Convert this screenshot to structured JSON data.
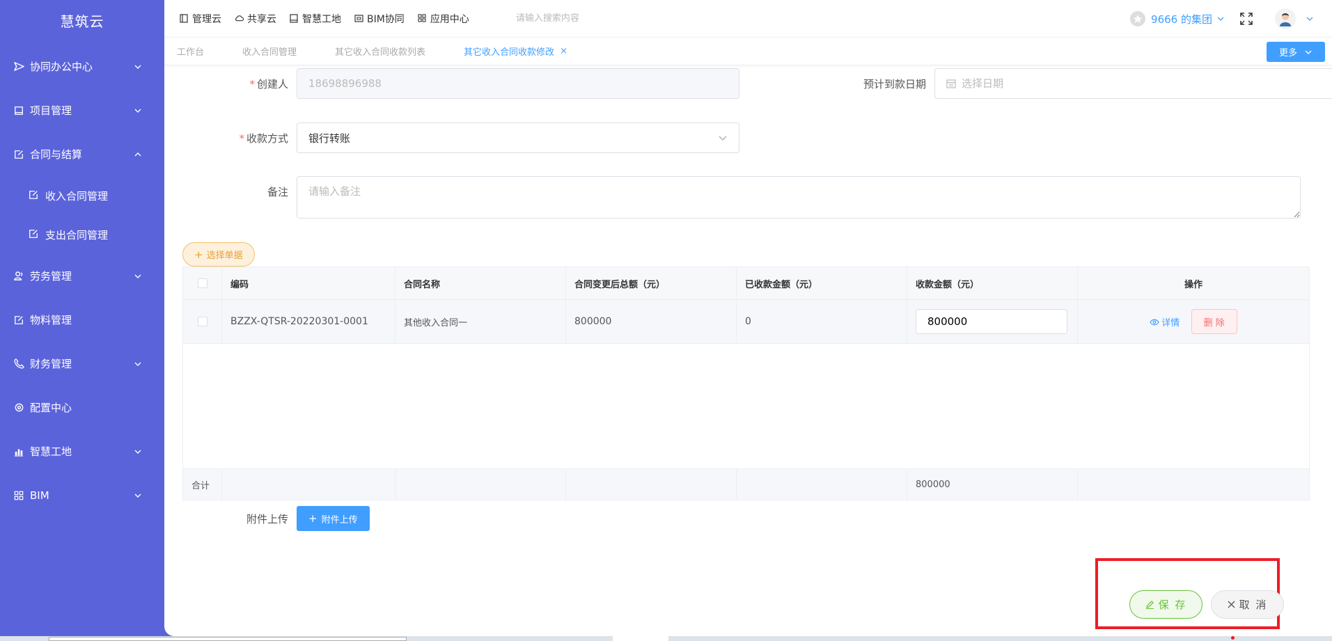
{
  "sidebar": {
    "logo": "慧筑云",
    "items": [
      {
        "label": "协同办公中心"
      },
      {
        "label": "项目管理"
      },
      {
        "label": "合同与结算"
      },
      {
        "label": "劳务管理"
      },
      {
        "label": "物料管理"
      },
      {
        "label": "财务管理"
      },
      {
        "label": "配置中心"
      },
      {
        "label": "智慧工地"
      },
      {
        "label": "BIM"
      }
    ],
    "sub_items": [
      {
        "label": "收入合同管理"
      },
      {
        "label": "支出合同管理"
      }
    ]
  },
  "topbar": {
    "links": [
      {
        "label": "管理云"
      },
      {
        "label": "共享云"
      },
      {
        "label": "智慧工地"
      },
      {
        "label": "BIM协同"
      },
      {
        "label": "应用中心"
      }
    ],
    "search_placeholder": "请输入搜索内容",
    "group_name": "9666 的集团"
  },
  "tabs": {
    "items": [
      {
        "label": "工作台"
      },
      {
        "label": "收入合同管理"
      },
      {
        "label": "其它收入合同收款列表"
      },
      {
        "label": "其它收入合同收款修改"
      }
    ],
    "close_glyph": "×",
    "more_label": "更多"
  },
  "form": {
    "creator_label": "创建人",
    "creator_value": "18698896988",
    "expected_date_label": "预计到款日期",
    "expected_date_placeholder": "选择日期",
    "payment_method_label": "收款方式",
    "payment_method_value": "银行转账",
    "remark_label": "备注",
    "remark_placeholder": "请输入备注",
    "required_mark": "*"
  },
  "select_bill_label": "选择单据",
  "table": {
    "headers": [
      "编码",
      "合同名称",
      "合同变更后总额（元）",
      "已收款金额（元）",
      "收款金额（元）",
      "操作"
    ],
    "rows": [
      {
        "code": "BZZX-QTSR-20220301-0001",
        "name": "其他收入合同一",
        "total": "800000",
        "received": "0",
        "amount": "800000"
      }
    ],
    "detail_label": "详情",
    "delete_label": "删 除",
    "sum_label": "合计",
    "sum_amount": "800000"
  },
  "upload": {
    "label": "附件上传",
    "button_label": "附件上传"
  },
  "actions": {
    "save_label": "保 存",
    "cancel_label": "取 消"
  },
  "colors": {
    "sidebar": "#5b63db",
    "primary": "#409eff",
    "success": "#67c23a",
    "danger": "#f56c6c",
    "warning": "#e6a23c",
    "highlight": "#ee1c25"
  }
}
